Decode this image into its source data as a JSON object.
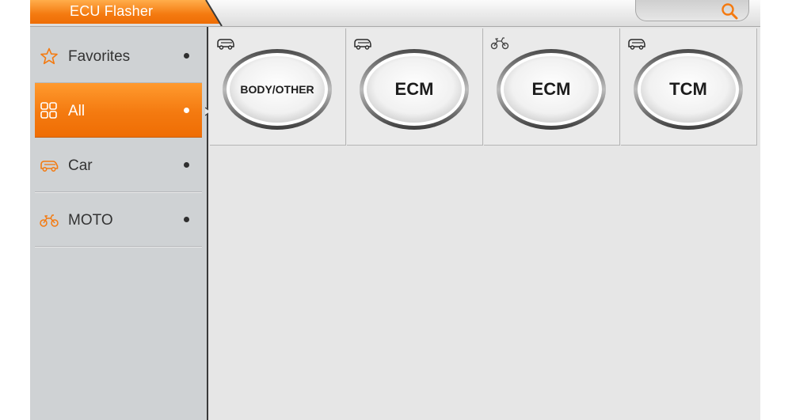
{
  "header": {
    "title": "ECU Flasher",
    "search_icon": "search-icon"
  },
  "sidebar": {
    "items": [
      {
        "label": "Favorites",
        "icon": "star-icon",
        "active": false
      },
      {
        "label": "All",
        "icon": "grid-icon",
        "active": true
      },
      {
        "label": "Car",
        "icon": "car-icon",
        "active": false
      },
      {
        "label": "MOTO",
        "icon": "motorcycle-icon",
        "active": false
      }
    ]
  },
  "modules": [
    {
      "label": "BODY/OTHER",
      "type_icon": "car-icon"
    },
    {
      "label": "ECM",
      "type_icon": "car-icon"
    },
    {
      "label": "ECM",
      "type_icon": "motorcycle-icon"
    },
    {
      "label": "TCM",
      "type_icon": "car-icon"
    }
  ],
  "colors": {
    "accent_orange": "#f47a10",
    "sidebar_bg": "#cfd2d4",
    "content_bg": "#e6e6e6"
  }
}
